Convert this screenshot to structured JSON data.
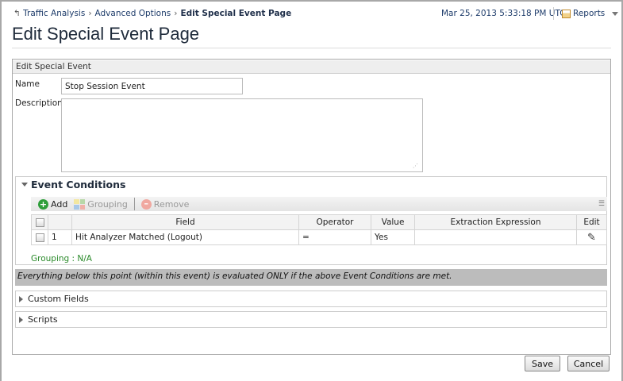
{
  "breadcrumb": {
    "items": [
      "Traffic Analysis",
      "Advanced Options"
    ],
    "current": "Edit Special Event Page"
  },
  "header": {
    "datetime": "Mar 25, 2013 5:33:18 PM UTC",
    "reports_label": "Reports"
  },
  "page_title": "Edit Special Event Page",
  "panel": {
    "title": "Edit Special Event",
    "name_label": "Name",
    "name_value": "Stop Session Event",
    "description_label": "Description",
    "description_value": ""
  },
  "conditions": {
    "title": "Event Conditions",
    "toolbar": {
      "add": "Add",
      "grouping": "Grouping",
      "remove": "Remove"
    },
    "columns": [
      "Field",
      "Operator",
      "Value",
      "Extraction Expression",
      "Edit"
    ],
    "rows": [
      {
        "num": "1",
        "field": "Hit Analyzer Matched (Logout)",
        "operator": "=",
        "value": "Yes",
        "extraction": ""
      }
    ],
    "grouping_text": "Grouping : N/A"
  },
  "notice": "Everything below this point (within this event) is evaluated ONLY if the above Event Conditions are met.",
  "sections": [
    "Custom Fields",
    "Scripts"
  ],
  "buttons": {
    "save": "Save",
    "cancel": "Cancel"
  }
}
